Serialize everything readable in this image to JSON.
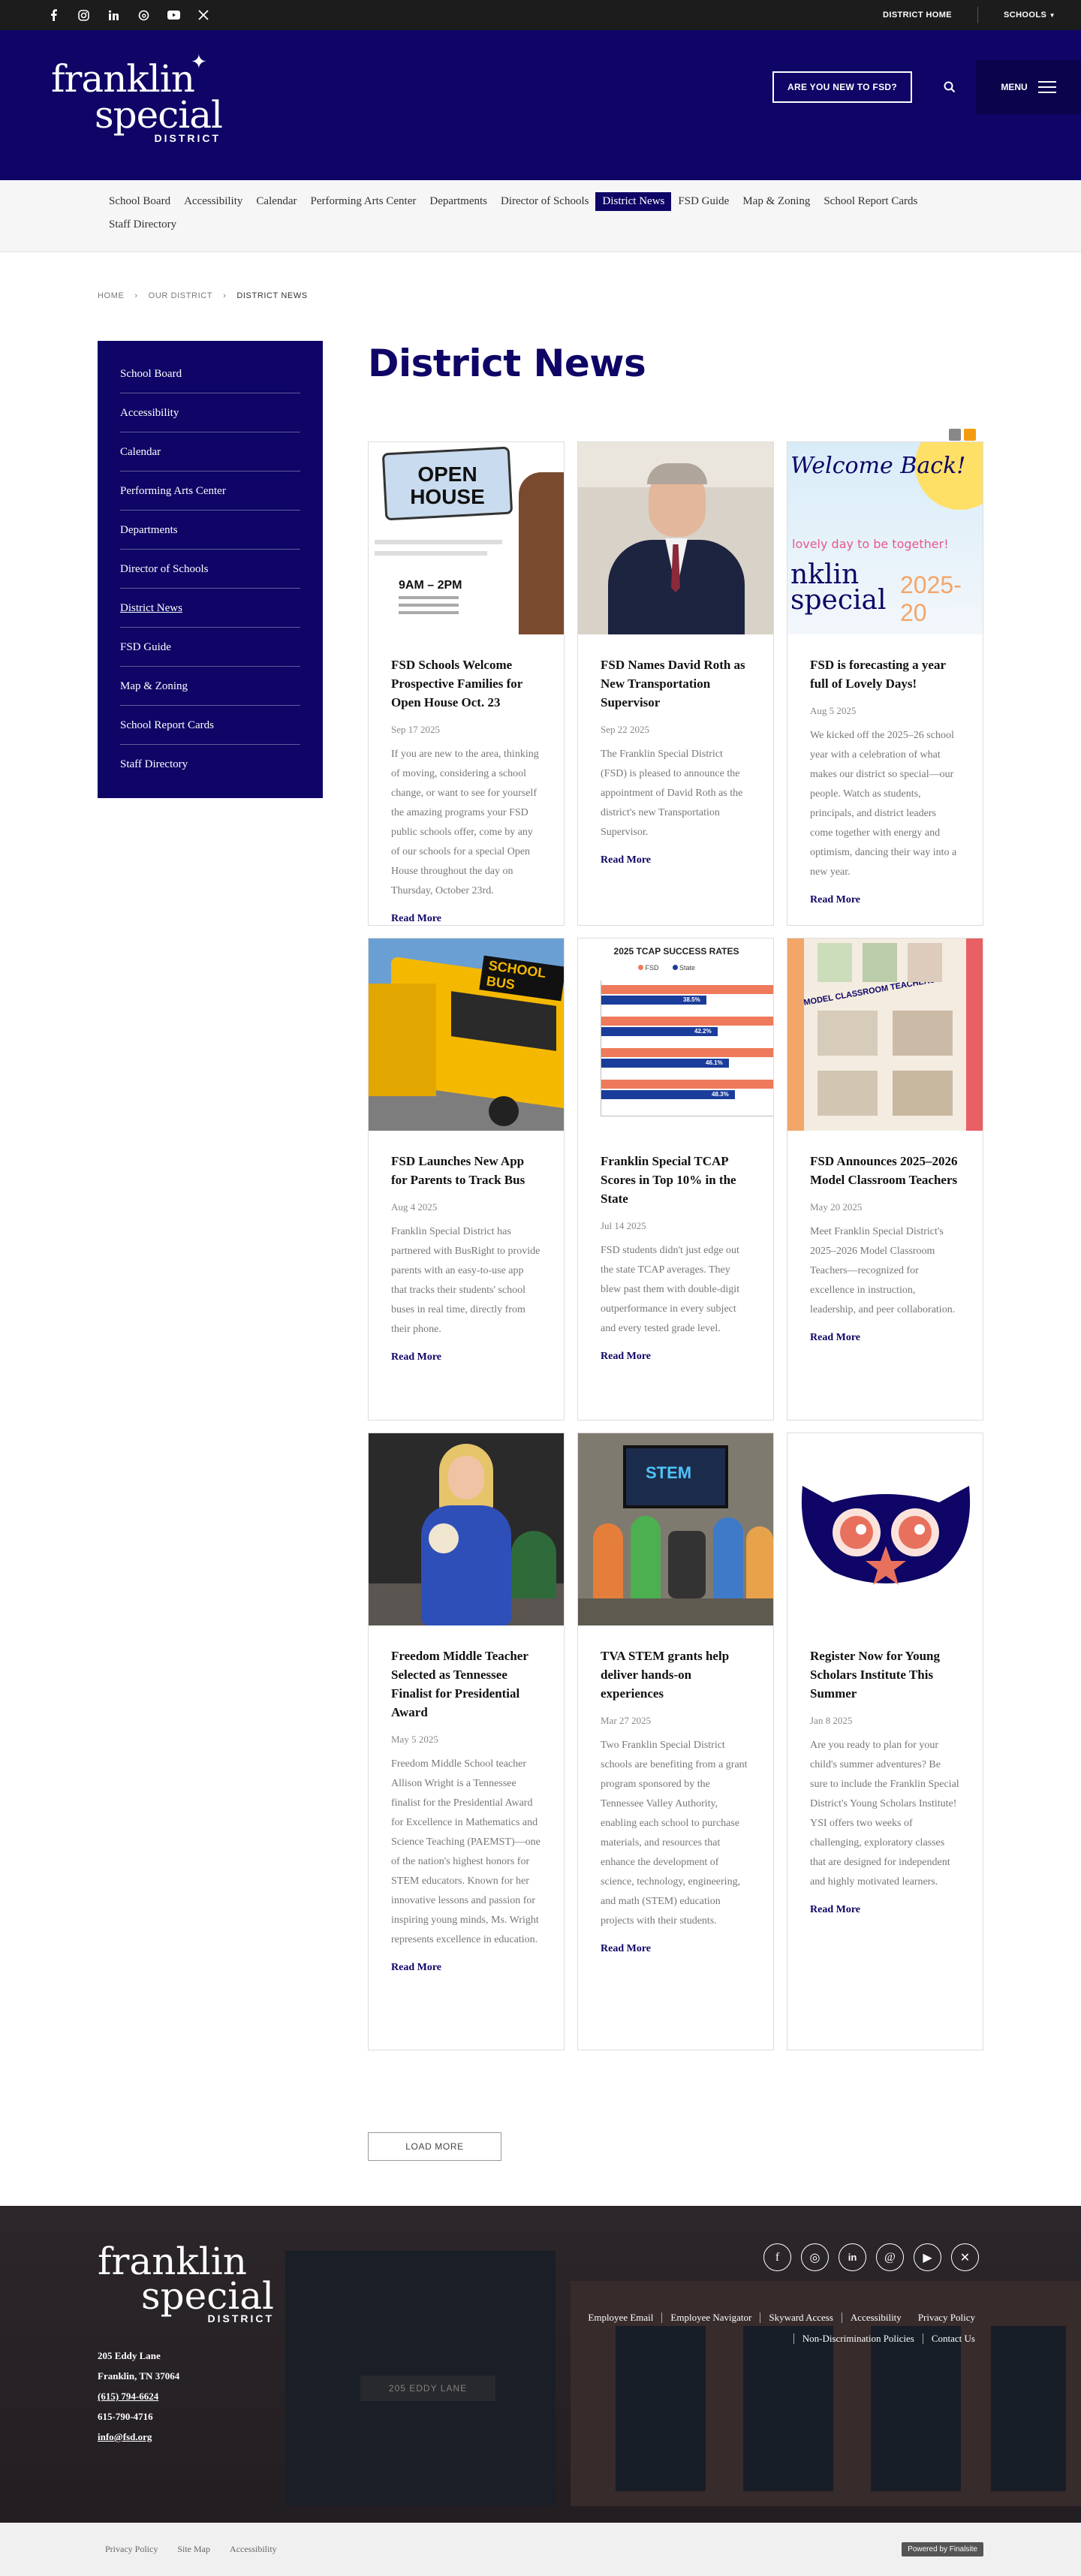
{
  "topbar": {
    "social": [
      "facebook-icon",
      "instagram-icon",
      "linkedin-icon",
      "threads-icon",
      "youtube-icon",
      "x-icon"
    ],
    "district_home": "DISTRICT HOME",
    "schools": "SCHOOLS"
  },
  "header": {
    "logo_line1": "franklin",
    "logo_line2": "special",
    "logo_line3": "DISTRICT",
    "new_button": "ARE YOU NEW TO FSD?",
    "menu_label": "MENU"
  },
  "subnav": [
    "School Board",
    "Accessibility",
    "Calendar",
    "Performing Arts Center",
    "Departments",
    "Director of Schools",
    "District News",
    "FSD Guide",
    "Map & Zoning",
    "School Report Cards",
    "Staff Directory"
  ],
  "breadcrumb": {
    "home": "HOME",
    "parent": "OUR DISTRICT",
    "current": "DISTRICT NEWS"
  },
  "sidebar": [
    "School Board",
    "Accessibility",
    "Calendar",
    "Performing Arts Center",
    "Departments",
    "Director of Schools",
    "District News",
    "FSD Guide",
    "Map & Zoning",
    "School Report Cards",
    "Staff Directory"
  ],
  "page_title": "District News",
  "news": [
    {
      "title": "FSD Schools Welcome Prospective Families for Open House Oct. 23",
      "date": "Sep 17 2025",
      "excerpt": "If you are new to the area, thinking of moving, considering a school change, or want to see for yourself the amazing programs your FSD public schools offer, come by any of our schools for a special Open House throughout the day on Thursday, October 23rd.",
      "read": "Read More"
    },
    {
      "title": "FSD Names David Roth as New Transportation Supervisor",
      "date": "Sep 22 2025",
      "excerpt": "The Franklin Special District (FSD) is pleased to announce the appointment of David Roth as the district's new Transportation Supervisor.",
      "read": "Read More"
    },
    {
      "title": "FSD is forecasting a year full of Lovely Days!",
      "date": "Aug 5 2025",
      "excerpt": "We kicked off the 2025–26 school year with a celebration of what makes our district so special—our people. Watch as students, principals, and district leaders come together with energy and optimism, dancing their way into a new year.",
      "read": "Read More"
    },
    {
      "title": "FSD Launches New App for Parents to Track Bus",
      "date": "Aug 4 2025",
      "excerpt": "Franklin Special District has partnered with BusRight to provide parents with an easy-to-use app that tracks their students' school buses in real time, directly from their phone.",
      "read": "Read More"
    },
    {
      "title": "Franklin Special TCAP Scores in Top 10% in the State",
      "date": "Jul 14 2025",
      "excerpt": "FSD students didn't just edge out the state TCAP averages. They blew past them with double-digit outperformance in every subject and every tested grade level.",
      "read": "Read More"
    },
    {
      "title": "FSD Announces 2025–2026 Model Classroom Teachers",
      "date": "May 20 2025",
      "excerpt": "Meet Franklin Special District's 2025–2026 Model Classroom Teachers—recognized for excellence in instruction, leadership, and peer collaboration.",
      "read": "Read More"
    },
    {
      "title": "Freedom Middle Teacher Selected as Tennessee Finalist for Presidential Award",
      "date": "May 5 2025",
      "excerpt": "Freedom Middle School teacher Allison Wright is a Tennessee finalist for the Presidential Award for Excellence in Mathematics and Science Teaching (PAEMST)—one of the nation's highest honors for STEM educators. Known for her innovative lessons and passion for inspiring young minds, Ms. Wright represents excellence in education.",
      "read": "Read More"
    },
    {
      "title": "TVA STEM grants help deliver hands-on experiences",
      "date": "Mar 27 2025",
      "excerpt": "Two Franklin Special District schools are benefiting from a grant program sponsored by the Tennessee Valley Authority, enabling each school to purchase materials, and resources that enhance the development of science, technology, engineering, and math (STEM) education projects with their students.",
      "read": "Read More"
    },
    {
      "title": "Register Now for Young Scholars Institute This Summer",
      "date": "Jan 8 2025",
      "excerpt": "Are you ready to plan for your child's summer adventures? Be sure to include the Franklin Special District's Young Scholars Institute! YSI offers two weeks of challenging, exploratory classes that are designed for independent and highly motivated learners.",
      "read": "Read More"
    }
  ],
  "thumbs": {
    "open_house": "OPEN HOUSE",
    "open_house_time": "9AM – 2PM",
    "welcome_back": "Welcome Back!",
    "lovely_day": "lovely day to be together!",
    "bus_sign": "SCHOOL BUS",
    "tcap_title": "2025 TCAP SUCCESS RATES",
    "tcap_legend": [
      "FSD",
      "State"
    ],
    "tcap_state": [
      "38.5%",
      "42.2%",
      "46.1%",
      "48.3%"
    ],
    "model_teachers": "MODEL CLASSROOM TEACHERS",
    "stem_screen": "STEM"
  },
  "load_more": "LOAD MORE",
  "footer": {
    "address1": "205 Eddy Lane",
    "address2": "Franklin, TN  37064",
    "phone1": "(615) 794-6624",
    "phone2": "615-790-4716",
    "email": "info@fsd.org",
    "building_sign": "205 EDDY LANE",
    "links": [
      "Employee Email",
      "Employee Navigator",
      "Skyward Access",
      "Accessibility",
      "Privacy Policy",
      "Non-Discrimination Policies",
      "Contact Us"
    ]
  },
  "bottom": {
    "privacy": "Privacy Policy",
    "sitemap": "Site Map",
    "accessibility": "Accessibility",
    "powered": "Powered by Finalsite"
  },
  "colors": {
    "brand": "#0e0566",
    "topbar": "#1c1c1c"
  }
}
